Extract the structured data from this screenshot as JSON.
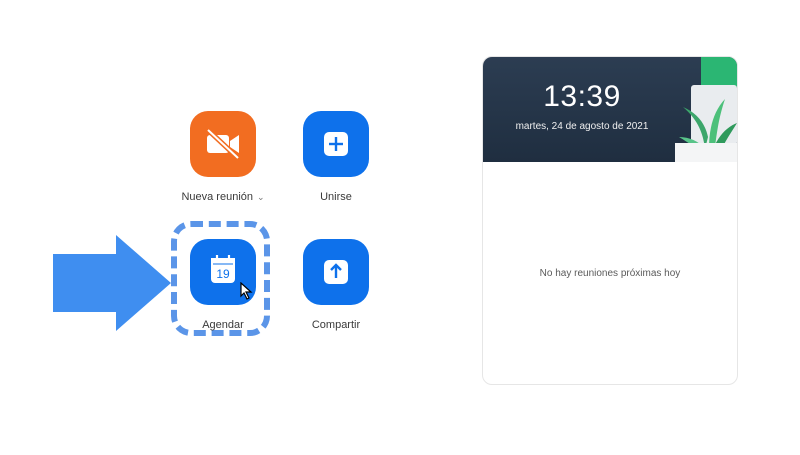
{
  "actions": {
    "new_meeting": {
      "label": "Nueva reunión",
      "chevron": "⌄",
      "icon": "video-off-icon",
      "color": "#f26d21"
    },
    "join": {
      "label": "Unirse",
      "icon": "plus-icon",
      "color": "#0e71eb"
    },
    "schedule": {
      "label": "Agendar",
      "icon": "calendar-icon",
      "day": "19",
      "color": "#0e71eb"
    },
    "share": {
      "label": "Compartir",
      "icon": "share-up-arrow-icon",
      "color": "#0e71eb"
    }
  },
  "annotation": {
    "pointer": "right-arrow-pointer",
    "highlight_color": "#5b95e8",
    "pointer_color": "#3f8ef0"
  },
  "panel": {
    "time": "13:39",
    "date": "martes, 24 de agosto de 2021",
    "empty_message": "No hay reuniones próximas hoy"
  }
}
